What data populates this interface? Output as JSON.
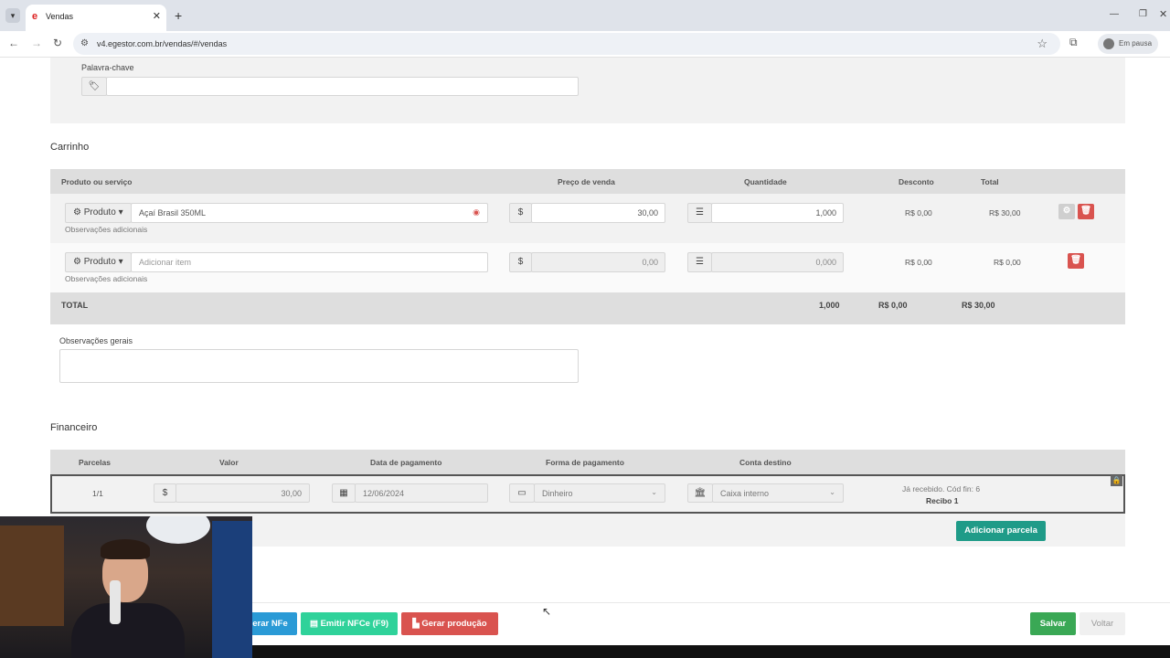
{
  "browser": {
    "tab_title": "Vendas",
    "url": "v4.egestor.com.br/vendas/#/vendas",
    "profile_label": "Em pausa"
  },
  "search_section": {
    "keyword_label": "Palavra-chave",
    "keyword_value": ""
  },
  "cart": {
    "title": "Carrinho",
    "headers": [
      "Produto ou serviço",
      "Preço de venda",
      "Quantidade",
      "Desconto",
      "Total"
    ],
    "rows": [
      {
        "type": "Produto",
        "item": "Açaí Brasil 350ML",
        "placeholder": "",
        "notes_label": "Observações adicionais",
        "currency": "$",
        "price": "30,00",
        "quantity": "1,000",
        "discount": "R$ 0,00",
        "total": "R$ 30,00"
      },
      {
        "type": "Produto",
        "item": "",
        "placeholder": "Adicionar item",
        "notes_label": "Observações adicionais",
        "currency": "$",
        "price": "0,00",
        "quantity": "0,000",
        "discount": "R$ 0,00",
        "total": "R$ 0,00"
      }
    ],
    "total_row": {
      "label": "TOTAL",
      "quantity": "1,000",
      "discount": "R$ 0,00",
      "total": "R$ 30,00"
    },
    "general_notes_label": "Observações gerais"
  },
  "financial": {
    "title": "Financeiro",
    "headers": [
      "Parcelas",
      "Valor",
      "Data de pagamento",
      "Forma de pagamento",
      "Conta destino"
    ],
    "row": {
      "installment": "1/1",
      "currency": "$",
      "value": "30,00",
      "date": "12/06/2024",
      "payment_method": "Dinheiro",
      "account": "Caixa interno",
      "status_line": "Já recebido. Cód fin: 6",
      "receipt": "Recibo 1"
    },
    "add_installment_label": "Adicionar parcela"
  },
  "footer_actions": {
    "nfe_label": "erar NFe",
    "nfce_label": "Emitir NFCe (F9)",
    "production_label": "Gerar produção",
    "save_label": "Salvar",
    "back_label": "Voltar"
  },
  "colors": {
    "danger": "#d9534f",
    "success": "#3aa855",
    "teal": "#1f9b88",
    "nfce": "#2fd29a",
    "blue": "#2a9ad6"
  }
}
